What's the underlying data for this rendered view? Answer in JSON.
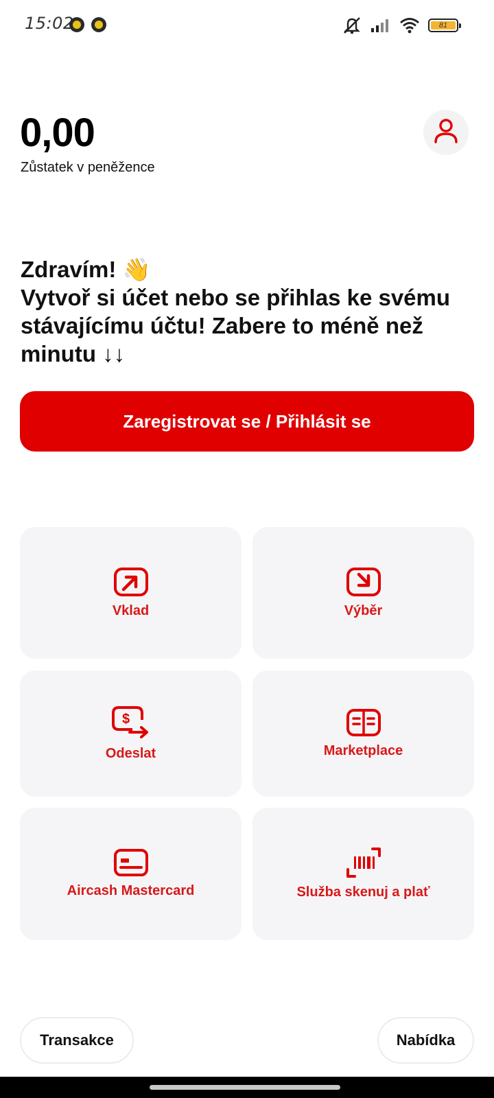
{
  "status_bar": {
    "time": "15:02",
    "battery_level": "81",
    "icons": [
      "notification-icon",
      "notification-icon",
      "mute-icon",
      "signal-icon",
      "wifi-icon",
      "battery-icon"
    ]
  },
  "wallet": {
    "balance": "0,00",
    "balance_label": "Zůstatek v peněžence"
  },
  "greeting": {
    "line1": "Zdravím! 👋",
    "line2": "Vytvoř si účet nebo se přihlas ke svému stávajícímu účtu! Zabere to méně než minutu ↓↓"
  },
  "cta": {
    "label": "Zaregistrovat se / Přihlásit se"
  },
  "tiles": [
    {
      "label": "Vklad",
      "icon": "deposit-icon"
    },
    {
      "label": "Výběr",
      "icon": "withdraw-icon"
    },
    {
      "label": "Odeslat",
      "icon": "send-money-icon"
    },
    {
      "label": "Marketplace",
      "icon": "marketplace-icon"
    },
    {
      "label": "Aircash Mastercard",
      "icon": "card-icon"
    },
    {
      "label": "Služba skenuj a plať",
      "icon": "scan-barcode-icon"
    }
  ],
  "bottom": {
    "left_label": "Transakce",
    "right_label": "Nabídka"
  },
  "colors": {
    "accent": "#e00000",
    "tile_bg": "#f5f5f7",
    "tile_text": "#d81818"
  }
}
